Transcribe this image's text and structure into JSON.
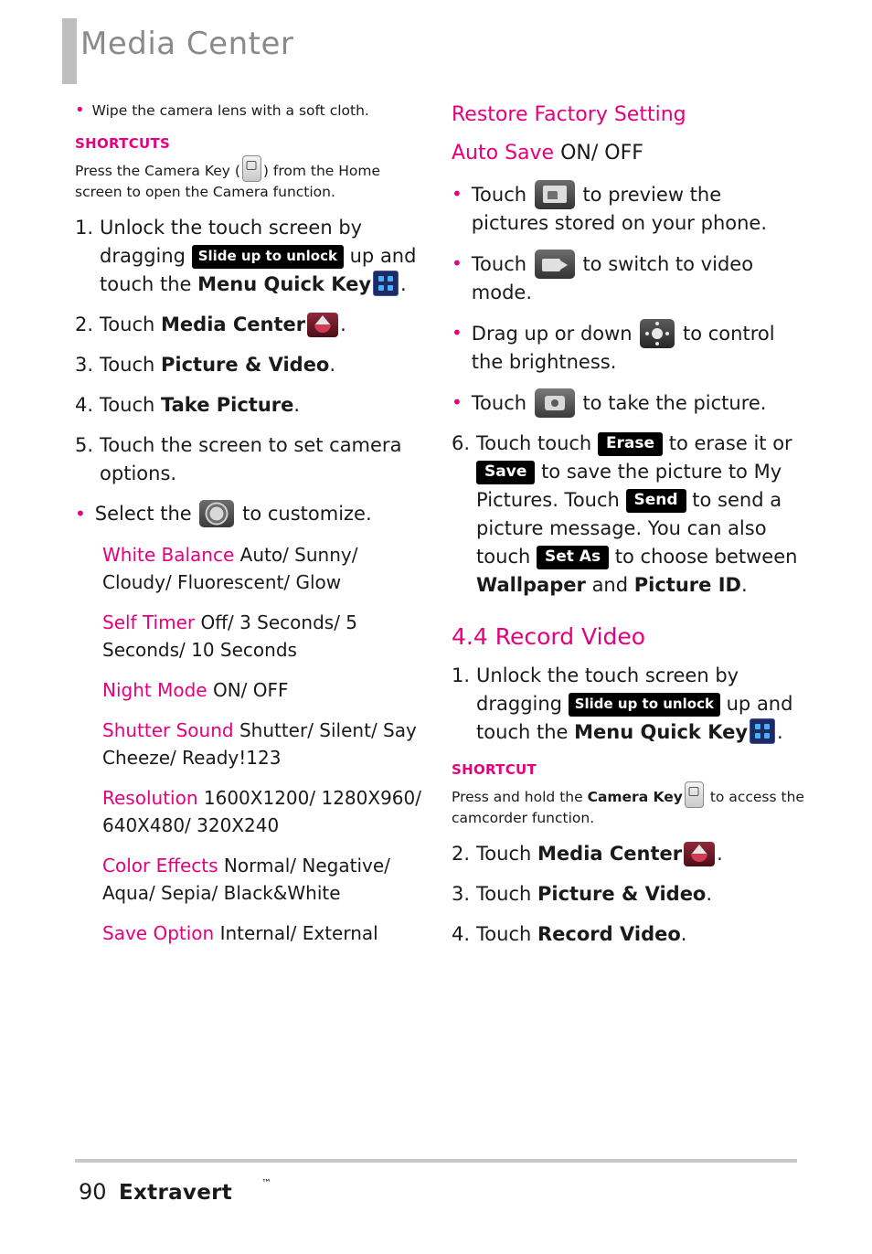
{
  "header": {
    "title": "Media Center"
  },
  "left": {
    "note": "Wipe the camera lens with a soft cloth.",
    "shortcuts_head": "SHORTCUTS",
    "shortcuts_body_1": "Press the Camera Key (",
    "shortcuts_body_2": ") from the Home screen to open the Camera function.",
    "steps": [
      {
        "num": "1.",
        "pre": "Unlock the touch screen by dragging",
        "chip": "Slide up to unlock",
        "mid": "up and touch the",
        "bold": "Menu Quick Key",
        "post": "."
      },
      {
        "num": "2.",
        "pre": "Touch",
        "bold": "Media Center",
        "post": "."
      },
      {
        "num": "3.",
        "pre": "Touch",
        "bold": "Picture & Video",
        "post": "."
      },
      {
        "num": "4.",
        "pre": "Touch",
        "bold": "Take Picture",
        "post": "."
      },
      {
        "num": "5.",
        "pre": "Touch the screen to set camera options.",
        "bold": "",
        "post": ""
      }
    ],
    "select_pre": "Select the",
    "select_post": "to customize.",
    "options": [
      {
        "name": "White Balance",
        "values": "Auto/ Sunny/ Cloudy/ Fluorescent/ Glow"
      },
      {
        "name": "Self Timer",
        "values": "Off/ 3 Seconds/ 5 Seconds/ 10 Seconds"
      },
      {
        "name": "Night Mode",
        "values": "ON/ OFF"
      },
      {
        "name": "Shutter Sound",
        "values": "Shutter/ Silent/ Say Cheeze/ Ready!123"
      },
      {
        "name": "Resolution",
        "values": "1600X1200/ 1280X960/ 640X480/ 320X240"
      },
      {
        "name": "Color Effects",
        "values": "Normal/ Negative/ Aqua/ Sepia/ Black&White"
      },
      {
        "name": "Save Option",
        "values": "Internal/ External"
      }
    ]
  },
  "right": {
    "opt_restore": "Restore Factory Setting",
    "opt_autosave_name": "Auto Save",
    "opt_autosave_val": "ON/ OFF",
    "bullets": [
      {
        "pre": "Touch",
        "icon": "gallery-icon",
        "post": "to preview the pictures stored on your phone."
      },
      {
        "pre": "Touch",
        "icon": "video-mode-icon",
        "post": "to switch to video mode."
      },
      {
        "pre": "Drag up or down",
        "icon": "brightness-icon",
        "post": "to control the brightness."
      },
      {
        "pre": "Touch",
        "icon": "shutter-icon",
        "post": "to take the picture."
      }
    ],
    "step6": {
      "num": "6.",
      "t1": "Touch touch",
      "chip_erase": "Erase",
      "t2": "to erase it or",
      "chip_save": "Save",
      "t3": "to save the picture to My Pictures. Touch",
      "chip_send": "Send",
      "t4": "to send a picture message. You can also touch",
      "chip_setas": "Set As",
      "t5": "to choose between",
      "b1": "Wallpaper",
      "t6": "and",
      "b2": "Picture ID",
      "t7": "."
    },
    "section_head": "4.4 Record Video",
    "steps": [
      {
        "num": "1.",
        "pre": "Unlock the touch screen by dragging",
        "chip": "Slide up to unlock",
        "mid": "up and touch the",
        "bold": "Menu Quick Key",
        "post": "."
      }
    ],
    "shortcut_head": "SHORTCUT",
    "shortcut_body_1": "Press and hold the",
    "shortcut_body_bold": "Camera Key",
    "shortcut_body_2": "to access the camcorder function.",
    "steps_tail": [
      {
        "num": "2.",
        "pre": "Touch",
        "bold": "Media Center",
        "post": "."
      },
      {
        "num": "3.",
        "pre": "Touch",
        "bold": "Picture & Video",
        "post": "."
      },
      {
        "num": "4.",
        "pre": "Touch",
        "bold": "Record Video",
        "post": "."
      }
    ]
  },
  "footer": {
    "page_number": "90",
    "brand": "Extravert",
    "tm": "™"
  }
}
